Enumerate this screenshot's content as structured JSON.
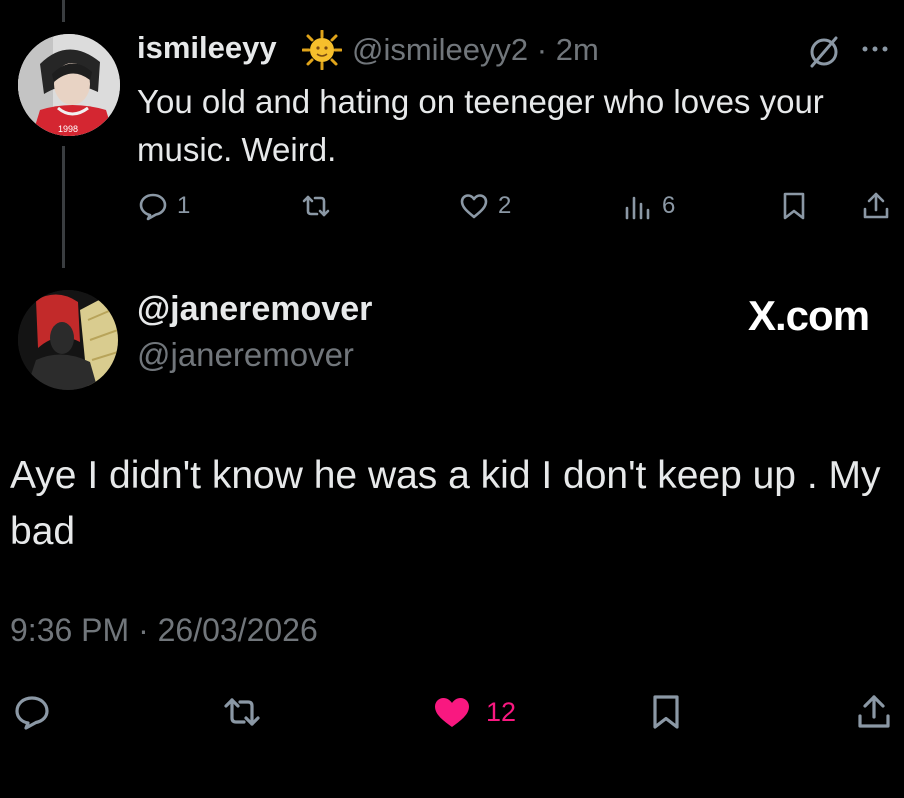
{
  "parent_tweet": {
    "display_name": "ismileeyy",
    "emoji": "sun-with-face",
    "handle_time": "@ismileeyy2 · 2m",
    "text": "You old and hating on teeneger who loves your music.  Weird.",
    "replies": "1",
    "likes": "2",
    "views": "6"
  },
  "main_tweet": {
    "display_name": "@janeremover",
    "handle": "@janeremover",
    "watermark": "X.com",
    "text": "Aye I didn't know he was a kid I don't keep up . My bad",
    "timestamp": "9:36 PM · 26/03/2026",
    "likes": "12"
  },
  "colors": {
    "background": "#000000",
    "text": "#e7e9ea",
    "secondary": "#71767b",
    "like_active": "#f91880"
  },
  "icons": [
    "reply-icon",
    "retweet-icon",
    "like-icon",
    "views-icon",
    "bookmark-icon",
    "share-icon",
    "more-icon",
    "slash-circle-icon"
  ]
}
